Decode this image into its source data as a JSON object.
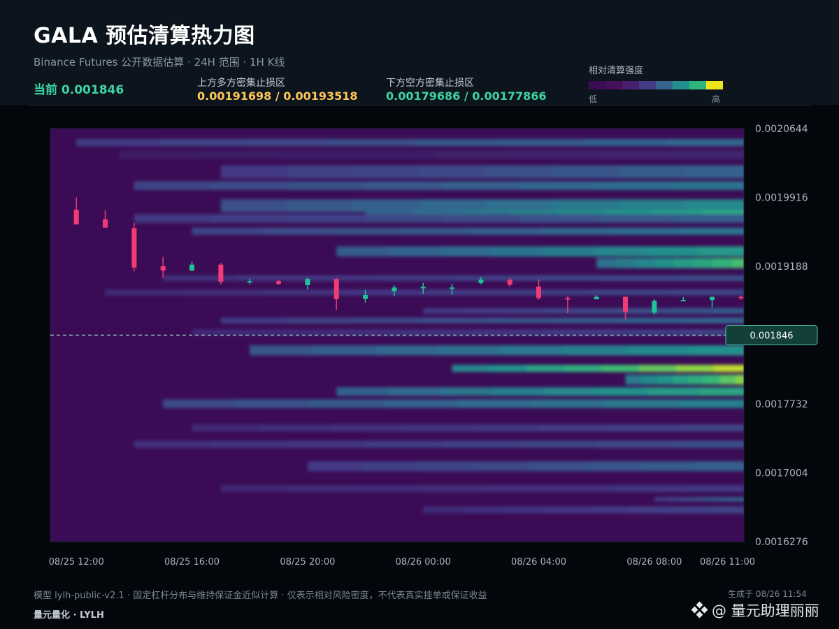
{
  "header": {
    "title": "GALA 预估清算热力图",
    "subtitle": "Binance Futures 公开数据估算 · 24H 范围 · 1H K线",
    "current_text": "当前 0.001846",
    "above_label": "上方多方密集止损区",
    "above_value": "0.00191698 / 0.00193518",
    "below_label": "下方空方密集止损区",
    "below_value": "0.00179686 / 0.00177866"
  },
  "legend": {
    "title": "相对清算强度",
    "low": "低",
    "high": "高",
    "colors": [
      "#3b0c55",
      "#441059",
      "#48206e",
      "#433c84",
      "#35638d",
      "#21908c",
      "#2fb47c",
      "#ece51a"
    ]
  },
  "footer": {
    "note": "模型 lylh-public-v2.1 · 固定杠杆分布与维持保证金近似计算 · 仅表示相对风险密度，不代表真实挂单或保证收益",
    "brand": "量元量化 · LYLH",
    "generated": "生成于 08/26 11:54",
    "watermark": "@ 量元助理丽丽"
  },
  "chart_data": {
    "type": "heatmap",
    "x_ticks": [
      "08/25 12:00",
      "08/25 16:00",
      "08/25 20:00",
      "08/26 00:00",
      "08/26 04:00",
      "08/26 08:00",
      "08/26 11:00"
    ],
    "x_tick_hours": [
      0,
      4,
      8,
      12,
      16,
      20,
      23
    ],
    "x_range_hours": [
      -0.9,
      23.1
    ],
    "y_ticks": [
      "0.0020644",
      "0.0019916",
      "0.0019188",
      "0.0018460",
      "0.0017732",
      "0.0017004",
      "0.0016276"
    ],
    "y_tick_values": [
      0.0020644,
      0.0019916,
      0.0019188,
      0.001846,
      0.0017732,
      0.0017004,
      0.0016276
    ],
    "ylim": [
      0.0016276,
      0.0020644
    ],
    "current_price": 0.001846,
    "current_price_label": "0.001846",
    "up_color": "#1fc398",
    "down_color": "#f03b75",
    "candles": [
      {
        "o": 0.0019786,
        "h": 0.0019916,
        "l": 0.0019715,
        "c": 0.001963
      },
      {
        "o": 0.0019685,
        "h": 0.001978,
        "l": 0.0019595,
        "c": 0.0019597
      },
      {
        "o": 0.0019591,
        "h": 0.0019648,
        "l": 0.0019135,
        "c": 0.0019176
      },
      {
        "o": 0.0019188,
        "h": 0.0019287,
        "l": 0.0019064,
        "c": 0.0019143
      },
      {
        "o": 0.0019143,
        "h": 0.0019235,
        "l": 0.0019135,
        "c": 0.0019205
      },
      {
        "o": 0.0019205,
        "h": 0.0019223,
        "l": 0.0018996,
        "c": 0.0019025
      },
      {
        "o": 0.0019025,
        "h": 0.0019058,
        "l": 0.0018997,
        "c": 0.0019031
      },
      {
        "o": 0.0019031,
        "h": 0.0019043,
        "l": 0.0018989,
        "c": 0.0019003
      },
      {
        "o": 0.0018988,
        "h": 0.0019073,
        "l": 0.0018942,
        "c": 0.0019054
      },
      {
        "o": 0.0019054,
        "h": 0.0019066,
        "l": 0.0018726,
        "c": 0.001884
      },
      {
        "o": 0.0018842,
        "h": 0.0018939,
        "l": 0.0018804,
        "c": 0.0018885
      },
      {
        "o": 0.0018924,
        "h": 0.0018987,
        "l": 0.0018872,
        "c": 0.0018963
      },
      {
        "o": 0.0018963,
        "h": 0.0019012,
        "l": 0.0018894,
        "c": 0.001897
      },
      {
        "o": 0.0018961,
        "h": 0.0019002,
        "l": 0.0018887,
        "c": 0.0018964
      },
      {
        "o": 0.0019013,
        "h": 0.0019076,
        "l": 0.0018997,
        "c": 0.0019046
      },
      {
        "o": 0.0019046,
        "h": 0.0019066,
        "l": 0.0018973,
        "c": 0.0018992
      },
      {
        "o": 0.0018973,
        "h": 0.0019053,
        "l": 0.0018835,
        "c": 0.0018852
      },
      {
        "o": 0.0018852,
        "h": 0.0018871,
        "l": 0.0018692,
        "c": 0.0018837
      },
      {
        "o": 0.0018839,
        "h": 0.0018883,
        "l": 0.0018842,
        "c": 0.0018865
      },
      {
        "o": 0.0018865,
        "h": 0.0018869,
        "l": 0.0018627,
        "c": 0.0018705
      },
      {
        "o": 0.0018697,
        "h": 0.0018841,
        "l": 0.0018675,
        "c": 0.0018822
      },
      {
        "o": 0.0018828,
        "h": 0.0018863,
        "l": 0.0018822,
        "c": 0.0018832
      },
      {
        "o": 0.0018831,
        "h": 0.0018869,
        "l": 0.0018751,
        "c": 0.0018864
      },
      {
        "o": 0.0018864,
        "h": 0.0018877,
        "l": 0.0018835,
        "c": 0.0018859
      }
    ],
    "heat_bands": [
      {
        "price": 0.0020496,
        "width": 7.7e-06,
        "intensity": 0.45,
        "start_hour": 0
      },
      {
        "price": 0.0020369,
        "width": 9.3e-06,
        "intensity": 0.14,
        "start_hour": 1.5
      },
      {
        "price": 0.0020188,
        "width": 1.38e-05,
        "intensity": 0.42,
        "start_hour": 5
      },
      {
        "price": 0.0020041,
        "width": 9.2e-06,
        "intensity": 0.5,
        "start_hour": 2
      },
      {
        "price": 0.0019828,
        "width": 1.36e-05,
        "intensity": 0.58,
        "start_hour": 5
      },
      {
        "price": 0.0019752,
        "width": 6.1e-06,
        "intensity": 0.72,
        "start_hour": 10
      },
      {
        "price": 0.0019693,
        "width": 9.2e-06,
        "intensity": 0.4,
        "start_hour": 2
      },
      {
        "price": 0.0019558,
        "width": 7.7e-06,
        "intensity": 0.5,
        "start_hour": 4
      },
      {
        "price": 0.0019345,
        "width": 1.07e-05,
        "intensity": 0.65,
        "start_hour": 9
      },
      {
        "price": 0.0019222,
        "width": 1.07e-05,
        "intensity": 0.8,
        "start_hour": 18
      },
      {
        "price": 0.0019063,
        "width": 6e-06,
        "intensity": 0.35,
        "start_hour": 3
      },
      {
        "price": 0.0018911,
        "width": 6e-06,
        "intensity": 0.32,
        "start_hour": 1
      },
      {
        "price": 0.0018716,
        "width": 6e-06,
        "intensity": 0.4,
        "start_hour": 12
      },
      {
        "price": 0.0018615,
        "width": 6e-06,
        "intensity": 0.45,
        "start_hour": 5
      },
      {
        "price": 0.001849,
        "width": 6e-06,
        "intensity": 0.3,
        "start_hour": 4
      },
      {
        "price": 0.0018299,
        "width": 1.07e-05,
        "intensity": 0.62,
        "start_hour": 6
      },
      {
        "price": 0.0018108,
        "width": 7.6e-06,
        "intensity": 0.95,
        "start_hour": 13
      },
      {
        "price": 0.0017989,
        "width": 1.06e-05,
        "intensity": 0.88,
        "start_hour": 19
      },
      {
        "price": 0.0017863,
        "width": 9.1e-06,
        "intensity": 0.7,
        "start_hour": 9
      },
      {
        "price": 0.0017735,
        "width": 9.1e-06,
        "intensity": 0.55,
        "start_hour": 3
      },
      {
        "price": 0.0017479,
        "width": 7.5e-06,
        "intensity": 0.3,
        "start_hour": 4
      },
      {
        "price": 0.0017306,
        "width": 7.5e-06,
        "intensity": 0.35,
        "start_hour": 2
      },
      {
        "price": 0.0017074,
        "width": 1.06e-05,
        "intensity": 0.42,
        "start_hour": 8
      },
      {
        "price": 0.0016837,
        "width": 7.5e-06,
        "intensity": 0.25,
        "start_hour": 5
      },
      {
        "price": 0.0016724,
        "width": 4.4e-06,
        "intensity": 0.45,
        "start_hour": 20
      },
      {
        "price": 0.0016612,
        "width": 7.5e-06,
        "intensity": 0.3,
        "start_hour": 12
      }
    ]
  }
}
